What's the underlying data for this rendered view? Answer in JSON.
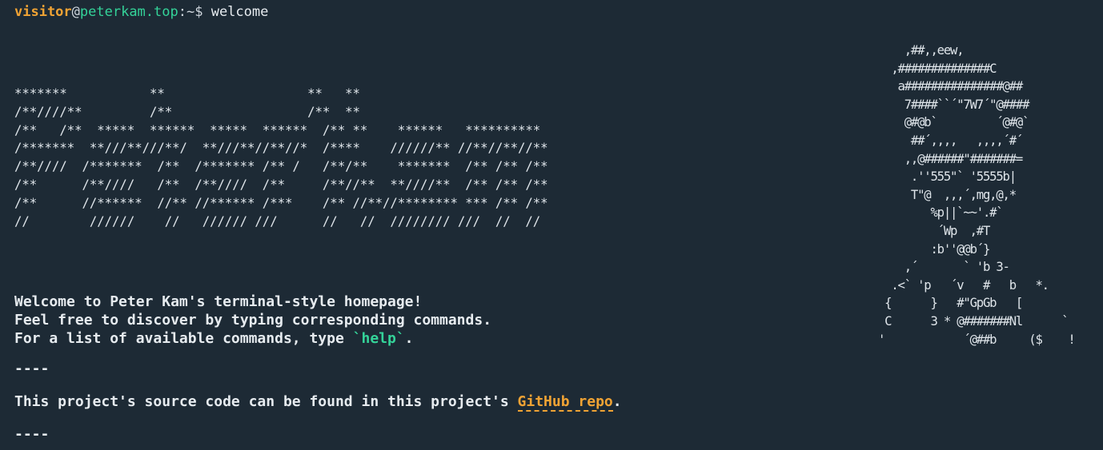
{
  "prompt": {
    "user": "visitor",
    "at": "@",
    "host": "peterkam.top",
    "path": ":~$",
    "command": "welcome"
  },
  "banner_ascii": "*******           **                   **   **\n/**////**         /**                  /**  **\n/**   /**  *****  ******  *****  ******  /** **    ******   **********\n/*******  **///**///**/  **///**//**//*  /****    //////** //**//**//**\n/**////  /*******  /**  /******* /** /   /**/**    *******  /** /** /**\n/**      /**////   /**  /**////  /**     /**//**  **////**  /** /** /**\n/**      //******  //** //****** /***    /** //**//******** *** /** /**\n//        //////    //   ////// ///      //   //  //////// ///  //  //",
  "portrait_ascii": "         ,##,,eew,\n       ,##############C\n        a###############@##\n         7####``´\"7W7´\"@####\n         @#@b`         ´@#@`\n          ##´,,,,   ,,,,´#´\n         ,,@######\"#######=\n          .''555\"` '5555b|\n          T\"@  ,,,´,mg,@,*\n             %p||`~~'.#`\n              ´Wp  ,#T\n             :b''@@b´}\n         ,´       ` 'b 3-\n       .<` 'p   ´v   #   b   *.\n      {      }   #\"GpGb   [\n      C      3 * @#######Nl      `\n     '            ´@##b     ($    !",
  "intro": {
    "line1": "Welcome to Peter Kam's terminal-style homepage!",
    "line2": "Feel free to discover by typing corresponding commands.",
    "line3_prefix": "For a list of available commands, type ",
    "line3_cmd": "`help`",
    "line3_suffix": "."
  },
  "divider": "----",
  "source": {
    "prefix": "This project's source code can be found in this project's ",
    "link_label": "GitHub repo",
    "suffix": "."
  },
  "colors": {
    "background": "#1d2a35",
    "prompt_user": "#f0a334",
    "prompt_host": "#34d399",
    "link": "#f0a334",
    "command_highlight": "#34d399"
  }
}
